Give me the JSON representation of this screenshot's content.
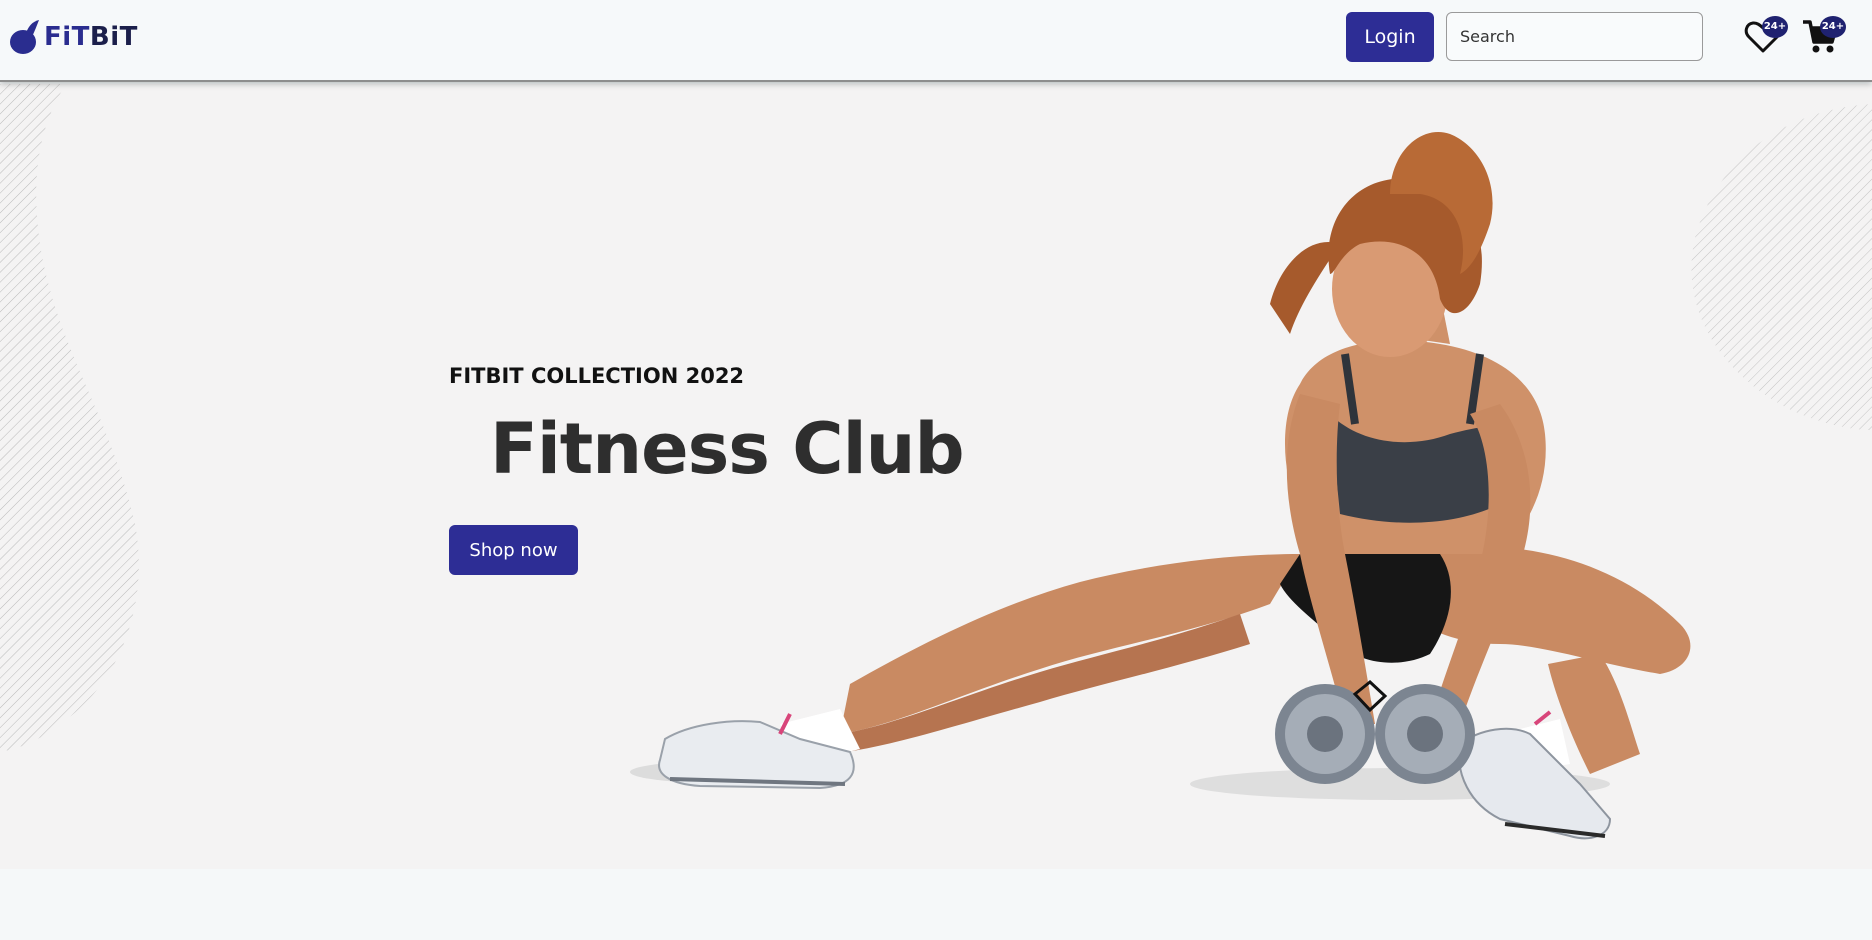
{
  "header": {
    "logo_text_part1": "FiT",
    "logo_text_part2": "BiT",
    "login_label": "Login",
    "search_placeholder": "Search",
    "wishlist": {
      "icon": "heart-icon",
      "badge": "24+"
    },
    "cart": {
      "icon": "cart-icon",
      "badge": "24+"
    }
  },
  "hero": {
    "kicker": "FITBIT COLLECTION 2022",
    "title": "Fitness Club",
    "cta_label": "Shop now",
    "image_icon": "athlete-with-dumbbells"
  },
  "colors": {
    "primary": "#2d2d95",
    "badge": "#1f2270",
    "hero_bg": "#f4f3f3",
    "header_bg": "#f6f9fa",
    "page_bg": "#f5f8f9"
  }
}
